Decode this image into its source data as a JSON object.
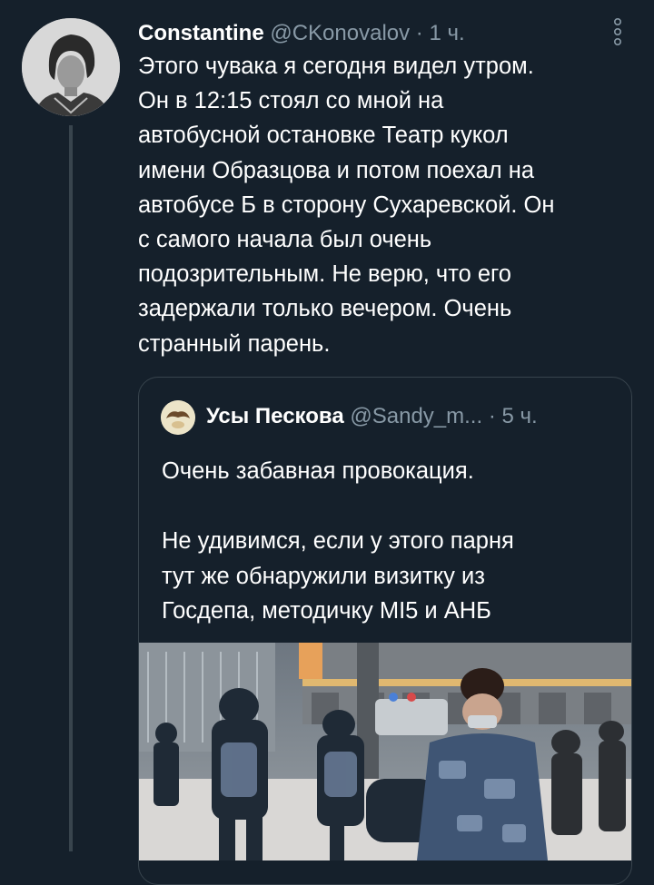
{
  "tweet": {
    "author_name": "Constantine",
    "author_handle": "@CKonovalov",
    "separator": "·",
    "time": "1 ч.",
    "text": "Этого чувака я сегодня видел утром.\nОн в 12:15 стоял со мной на\nавтобусной остановке Театр кукол\nимени Образцова и потом поехал на\nавтобусе Б в сторону Сухаревской. Он\nс самого начала был очень\nподозрительным. Не верю, что его\nзадержали только вечером. Очень\nстранный парень.",
    "more_icon": "more-vertical-icon"
  },
  "quoted": {
    "author_name": "Усы Пескова",
    "author_handle": "@Sandy_m...",
    "separator": "·",
    "time": "5 ч.",
    "text": "Очень забавная провокация.\n\nНе удивимся, если у этого парня\nтут же обнаружили визитку из\nГосдепа, методичку МI5 и АНБ",
    "media": "photo"
  },
  "colors": {
    "background": "#15202b",
    "border": "#38444d",
    "secondary_text": "#8899a6",
    "primary_text": "#ffffff"
  }
}
